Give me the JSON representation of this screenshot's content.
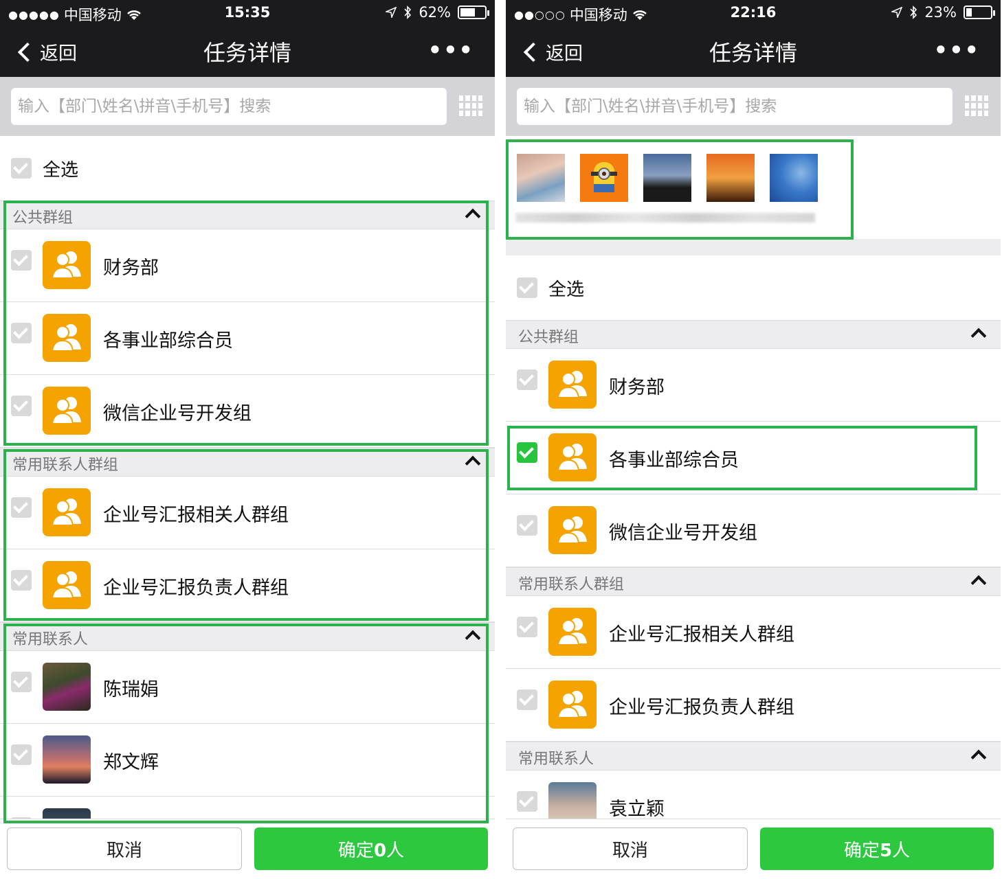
{
  "left": {
    "status": {
      "carrier": "中国移动",
      "time": "15:35",
      "battery": "62%",
      "battery_level": 0.62,
      "signal": "●●●●●"
    },
    "nav": {
      "back_label": "返回",
      "title": "任务详情",
      "more": "•••"
    },
    "search": {
      "placeholder": "输入【部门\\姓名\\拼音\\手机号】搜索"
    },
    "select_all": "全选",
    "sections": [
      {
        "title": "公共群组",
        "items": [
          "财务部",
          "各事业部综合员",
          "微信企业号开发组"
        ]
      },
      {
        "title": "常用联系人群组",
        "items": [
          "企业号汇报相关人群组",
          "企业号汇报负责人群组"
        ]
      },
      {
        "title": "常用联系人",
        "items": [
          "陈瑞娟",
          "郑文辉"
        ]
      }
    ],
    "buttons": {
      "cancel": "取消",
      "confirm_prefix": "确定",
      "confirm_count": "0",
      "confirm_suffix": "人"
    }
  },
  "right": {
    "status": {
      "carrier": "中国移动",
      "time": "22:16",
      "battery": "23%",
      "battery_level": 0.23,
      "signal": "●●○○○"
    },
    "nav": {
      "back_label": "返回",
      "title": "任务详情",
      "more": "•••"
    },
    "search": {
      "placeholder": "输入【部门\\姓名\\拼音\\手机号】搜索"
    },
    "select_all": "全选",
    "sections": [
      {
        "title": "公共群组",
        "items": [
          "财务部",
          "各事业部综合员",
          "微信企业号开发组"
        ]
      },
      {
        "title": "常用联系人群组",
        "items": [
          "企业号汇报相关人群组",
          "企业号汇报负责人群组"
        ]
      },
      {
        "title": "常用联系人",
        "items": [
          "袁立颖"
        ]
      }
    ],
    "buttons": {
      "cancel": "取消",
      "confirm_prefix": "确定",
      "confirm_count": "5",
      "confirm_suffix": "人"
    }
  },
  "colors": {
    "accent": "#2dc840",
    "highlight": "#2bb24c",
    "group_avatar": "#f5a300",
    "nav_bg": "#1b1b1d"
  },
  "icons": [
    "back-chevron-icon",
    "more-icon",
    "grid-icon",
    "checkbox-icon",
    "group-avatar-icon",
    "chevron-up-icon",
    "wifi-icon",
    "location-icon",
    "bluetooth-icon",
    "battery-icon"
  ]
}
